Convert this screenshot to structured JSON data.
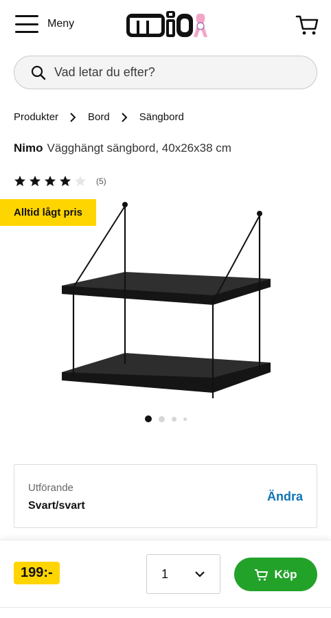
{
  "header": {
    "menu_label": "Meny",
    "logo_text": "mio",
    "cart_icon": "cart-icon"
  },
  "search": {
    "placeholder": "Vad letar du efter?"
  },
  "breadcrumb": [
    "Produkter",
    "Bord",
    "Sängbord"
  ],
  "product": {
    "brand": "Nimo",
    "description": "Vägghängt sängbord, 40x26x38 cm",
    "rating": 4,
    "rating_max": 5,
    "review_count": "(5)",
    "badge": "Alltid lågt pris",
    "image_count": 4,
    "active_image": 1
  },
  "variant": {
    "label": "Utförande",
    "value": "Svart/svart",
    "change_label": "Ändra"
  },
  "purchase": {
    "price": "199:-",
    "quantity": "1",
    "buy_label": "Köp"
  },
  "colors": {
    "accent_yellow": "#ffd500",
    "buy_green": "#23a22a",
    "link_blue": "#1073b7"
  }
}
